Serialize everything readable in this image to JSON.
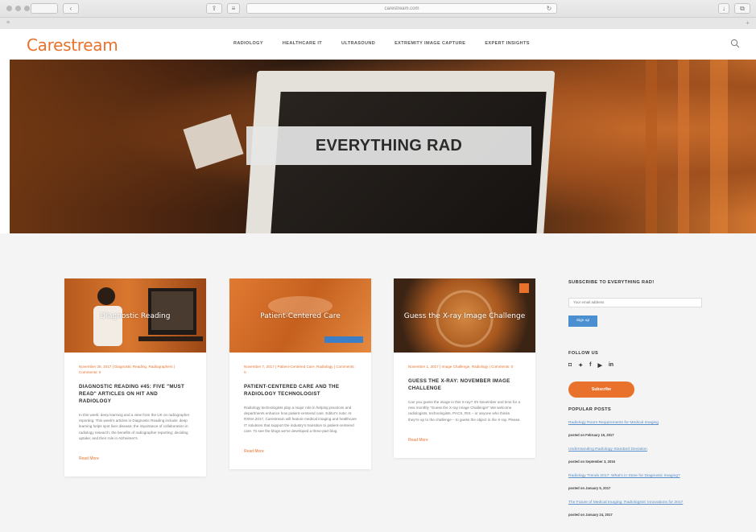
{
  "browser": {
    "url": "carestream.com"
  },
  "site": {
    "logo": "Carestream",
    "nav": [
      "RADIOLOGY",
      "HEALTHCARE IT",
      "ULTRASOUND",
      "EXTREMITY IMAGE CAPTURE",
      "EXPERT INSIGHTS"
    ],
    "accent_color": "#e8722c"
  },
  "hero": {
    "title": "EVERYTHING RAD"
  },
  "cards": [
    {
      "image_label": "Diagnostic Reading",
      "meta": "November 28, 2017 | Diagnostic Reading, Radiographers | Comments: 0",
      "title": "DIAGNOSTIC READING #45: FIVE \"MUST READ\" ARTICLES ON HIT AND RADIOLOGY",
      "excerpt": "In this week: deep learning and a view from the UK on radiographer reporting. This week's articles in Diagnostic Reading include: deep learning helps spot liver disease; the importance of collaboration in radiology research; the benefits of radiographer reporting; deciding uptake; and their role in Alzheimer's.",
      "read_more": "Read More"
    },
    {
      "image_label": "Patient-Centered Care",
      "meta": "November 7, 2017 | Patient-Centered Care, Radiology | Comments: 0",
      "title": "PATIENT-CENTERED CARE AND THE RADIOLOGY TECHNOLOGIST",
      "excerpt": "Radiology technologists play a major role in helping practices and departments enhance how patient-centered care. Editor's note: At RSNA 2017, Carestream will feature medical imaging and healthcare IT solutions that support the industry's transition to patient-centered care. To see the blogs we've developed a three-part blog.",
      "read_more": "Read More"
    },
    {
      "image_label": "Guess the X-ray Image Challenge",
      "meta": "November 1, 2017 | Image Challenge, Radiology | Comments: 0",
      "title": "GUESS THE X-RAY: NOVEMBER IMAGE CHALLENGE",
      "excerpt": "Can you guess the image in this X-ray? It's November and time for a new monthly \"Guess the X-ray Image Challenge!\" We welcome radiologists, technologists, PACS, RIS – or anyone who thinks they're up to the challenge – to guess the object in the X-ray. Please.",
      "read_more": "Read More"
    }
  ],
  "sidebar": {
    "subscribe_heading": "SUBSCRIBE TO EVERYTHING RAD!",
    "email_placeholder": "Your email address",
    "signup_label": "Sign up",
    "follow_heading": "FOLLOW US",
    "social": [
      "ig",
      "tw",
      "fb",
      "yt",
      "in"
    ],
    "subscribe_button": "Subscribe",
    "popular_heading": "POPULAR POSTS",
    "popular_posts": [
      {
        "title": "Radiology Room Requirements for Medical Imaging",
        "date": "posted on February 16, 2017"
      },
      {
        "title": "Understanding Radiology Standard Deviation",
        "date": "posted on September 3, 2016"
      },
      {
        "title": "Radiology Trends 2017: What's in Store for Diagnostic Imaging?",
        "date": "posted on January 5, 2017"
      },
      {
        "title": "The Future of Medical Imaging: Radiologists' Innovations for 2017",
        "date": "posted on January 24, 2017"
      }
    ]
  }
}
